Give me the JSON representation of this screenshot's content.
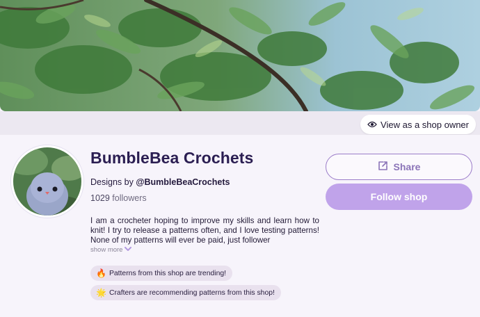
{
  "banner": {
    "alt": "tree canopy"
  },
  "header": {
    "view_owner_label": "View as a shop owner"
  },
  "shop": {
    "name": "BumbleBea Crochets",
    "designs_by_prefix": "Designs by ",
    "designs_by_handle": "@BumbleBeaCrochets",
    "followers_count": "1029",
    "followers_label": " followers",
    "bio": "I am a crocheter hoping to improve my skills and learn how to knit!  I try to release a patterns often, and I love testing patterns! None of my patterns will ever be paid, just follower",
    "show_more_label": "show more"
  },
  "badges": [
    {
      "emoji": "🔥",
      "text": "Patterns from this shop are trending!"
    },
    {
      "emoji": "🌟",
      "text": "Crafters are recommending patterns from this shop!"
    }
  ],
  "actions": {
    "share_label": "Share",
    "follow_label": "Follow shop"
  },
  "colors": {
    "accent": "#c0a3ea",
    "accent_border": "#9b7cc9",
    "title": "#2b1e52"
  },
  "icons": {
    "view_owner": "eye-icon",
    "share": "share-icon",
    "show_more": "chevron-down-icon"
  }
}
